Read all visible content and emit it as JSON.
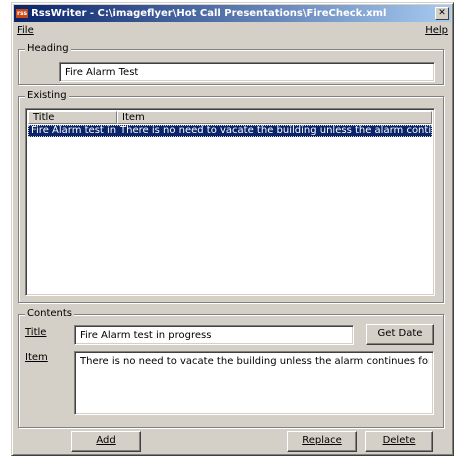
{
  "window": {
    "title_icon": "rss",
    "title": "RssWriter - C:\\imageflyer\\Hot Call Presentations\\FireCheck.xml",
    "close_label": "✕"
  },
  "menu": {
    "file": "File",
    "help": "Help"
  },
  "heading": {
    "group_label": "Heading",
    "value": "Fire Alarm Test"
  },
  "existing": {
    "group_label": "Existing",
    "columns": [
      "Title",
      "Item"
    ],
    "rows": [
      {
        "title": "Fire Alarm test in...",
        "item": "There is no need to vacate the building unless the alarm continu..."
      }
    ]
  },
  "contents": {
    "group_label": "Contents",
    "title_label": "Title",
    "title_value": "Fire Alarm test in progress",
    "get_date_label": "Get Date",
    "item_label": "Item",
    "item_value": "There is no need to vacate the building unless the alarm continues for more tha"
  },
  "buttons": {
    "add": "Add",
    "replace": "Replace",
    "delete": "Delete"
  },
  "colors": {
    "titlebar_start": "#0a246a",
    "titlebar_end": "#a6caf0",
    "selection": "#0a246a",
    "face": "#d4d0c8"
  }
}
